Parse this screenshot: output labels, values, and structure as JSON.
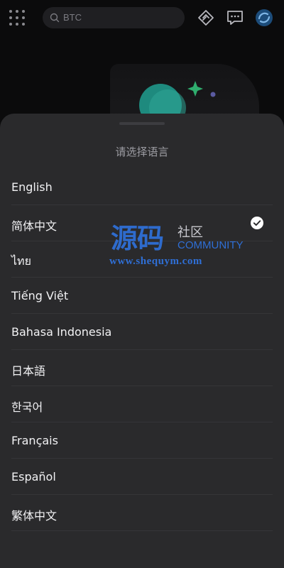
{
  "topbar": {
    "search_placeholder": "BTC",
    "icons": [
      "grid-menu-icon",
      "search-icon",
      "diamond-link-icon",
      "message-icon",
      "avatar-logo-icon"
    ]
  },
  "sheet": {
    "title": "请选择语言",
    "languages": [
      {
        "label": "English",
        "selected": false
      },
      {
        "label": "简体中文",
        "selected": true
      },
      {
        "label": "ไทย",
        "selected": false
      },
      {
        "label": "Tiếng Việt",
        "selected": false
      },
      {
        "label": "Bahasa Indonesia",
        "selected": false
      },
      {
        "label": "日本語",
        "selected": false
      },
      {
        "label": "한국어",
        "selected": false
      },
      {
        "label": "Français",
        "selected": false
      },
      {
        "label": "Español",
        "selected": false
      },
      {
        "label": "繁体中文",
        "selected": false
      }
    ]
  },
  "watermark": {
    "main": "源码",
    "side": "社区",
    "community": "COMMUNITY",
    "url": "www.shequym.com"
  },
  "colors": {
    "background": "#0b0b0c",
    "sheet": "#2a2a2c",
    "accent_teal": "#1e8a7e",
    "watermark_blue": "#2f6fd6"
  }
}
